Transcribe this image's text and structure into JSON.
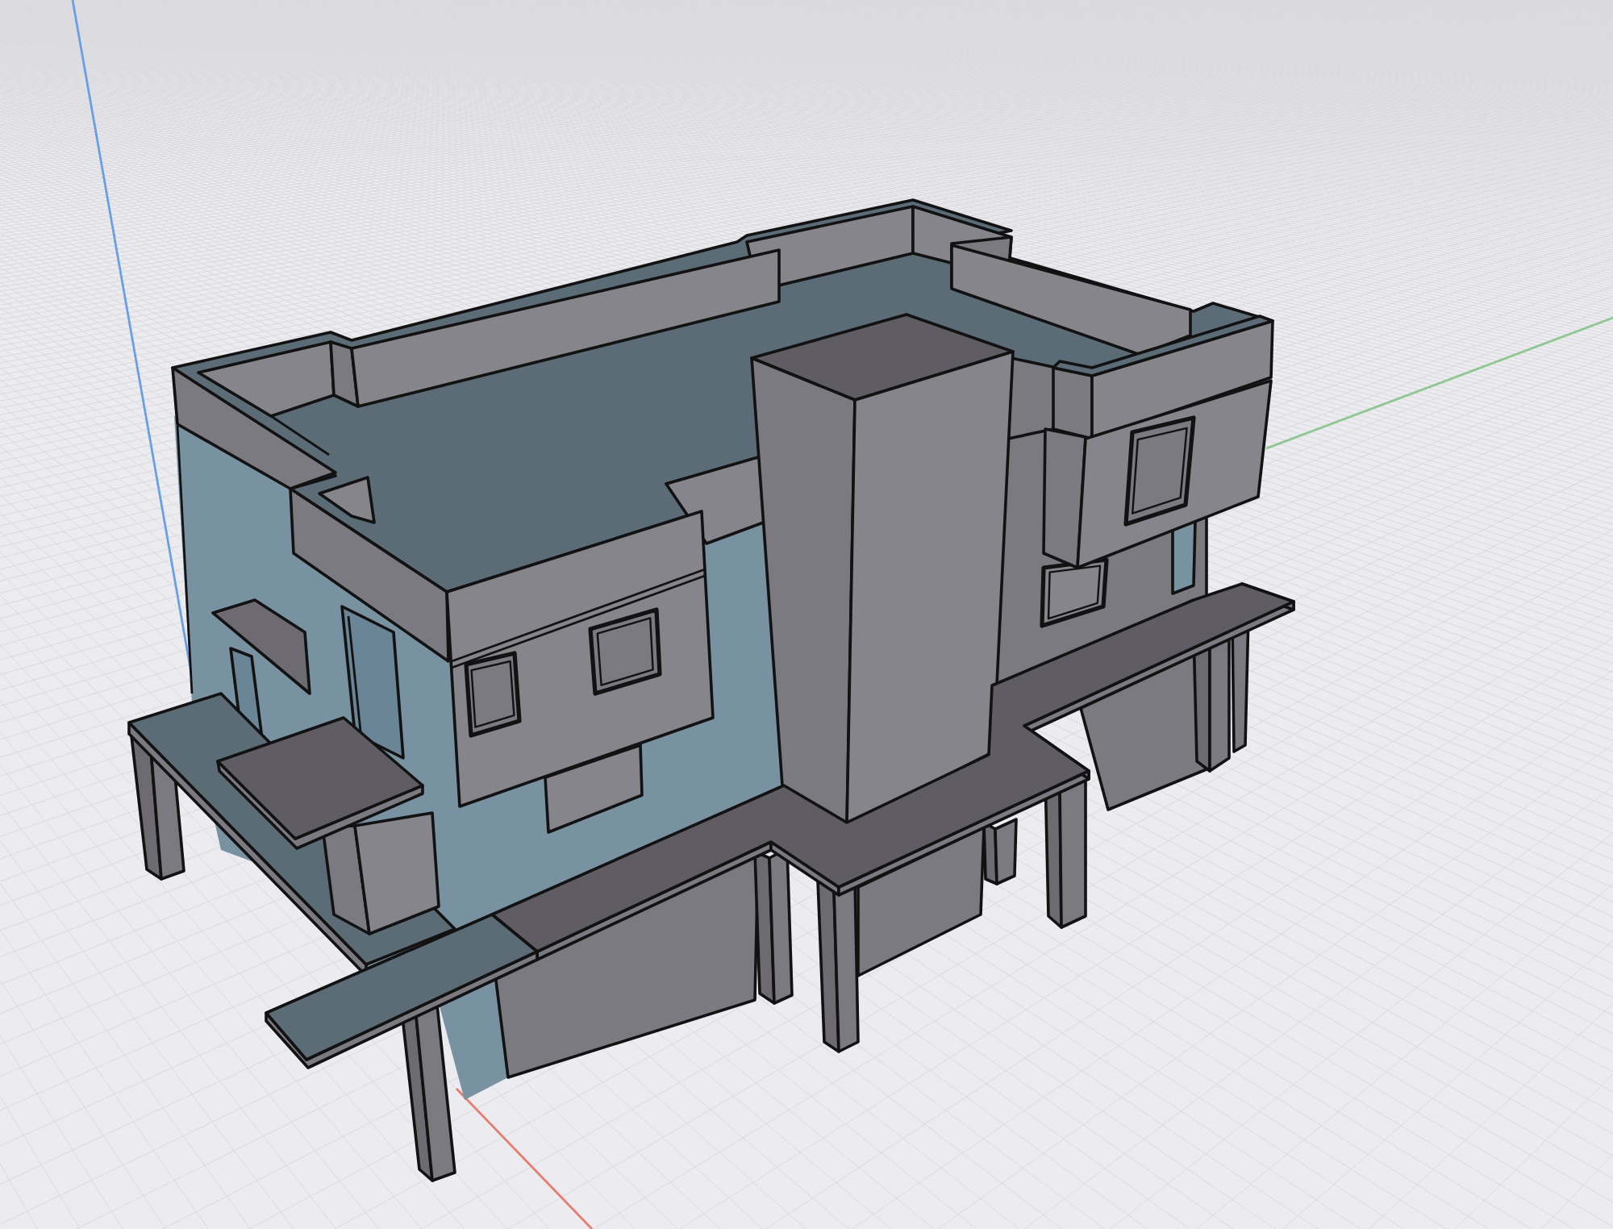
{
  "viewport": {
    "axes": [
      {
        "color": "#6a9fe3"
      },
      {
        "color": "#8fc792"
      },
      {
        "color": "#e27f70"
      }
    ]
  }
}
